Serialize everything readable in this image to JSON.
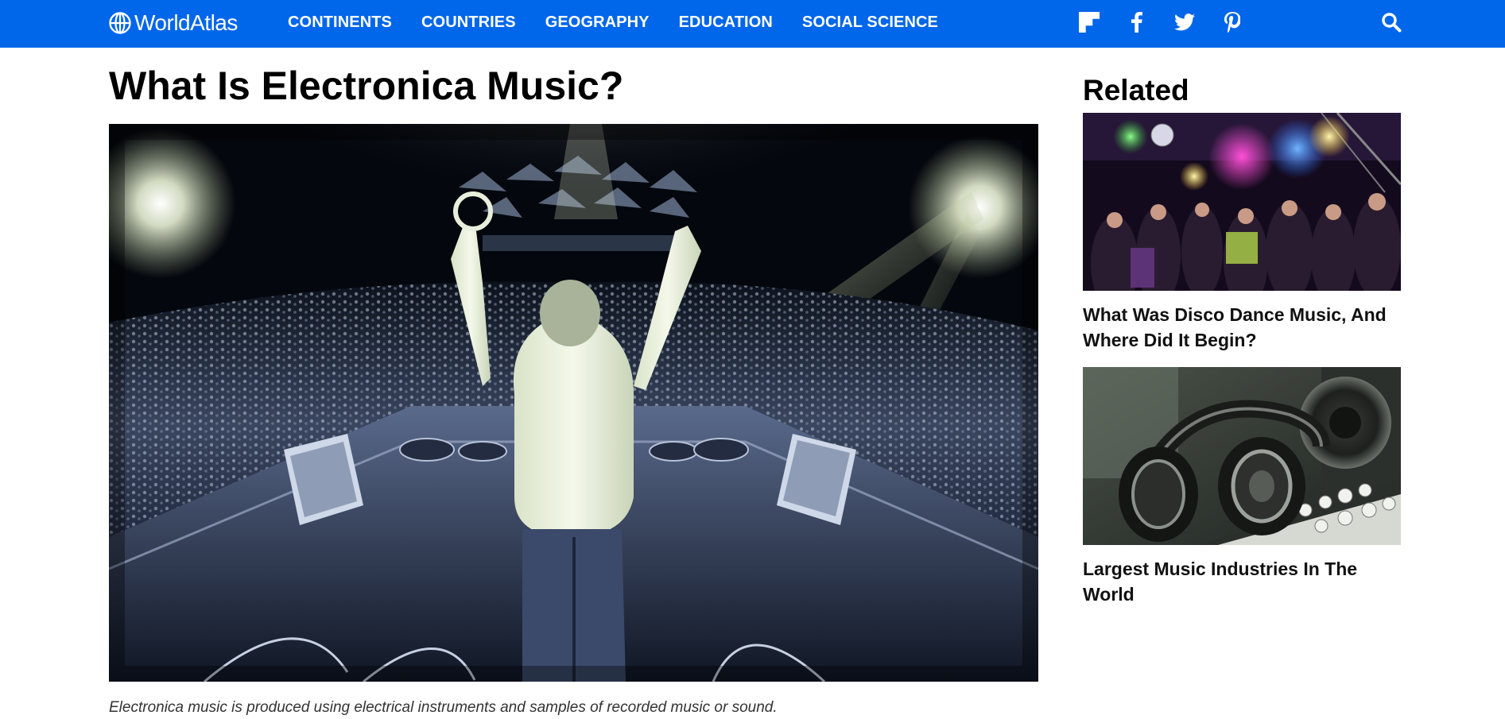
{
  "brand": {
    "name": "WorldAtlas",
    "logo_icon": "globe-icon"
  },
  "nav": {
    "items": [
      "CONTINENTS",
      "COUNTRIES",
      "GEOGRAPHY",
      "EDUCATION",
      "SOCIAL SCIENCE"
    ]
  },
  "social": {
    "icons": [
      "flipboard-icon",
      "facebook-icon",
      "twitter-icon",
      "pinterest-icon"
    ]
  },
  "search": {
    "icon": "search-icon"
  },
  "colors": {
    "header_bg": "#0066ea",
    "text": "#000000",
    "caption": "#333333"
  },
  "article": {
    "title": "What Is Electronica Music?",
    "caption": "Electronica music is produced using electrical instruments and samples of recorded music or sound."
  },
  "related": {
    "heading": "Related",
    "items": [
      {
        "title": "What Was Disco Dance Music, And Where Did It Begin?"
      },
      {
        "title": "Largest Music Industries In The World"
      }
    ]
  }
}
